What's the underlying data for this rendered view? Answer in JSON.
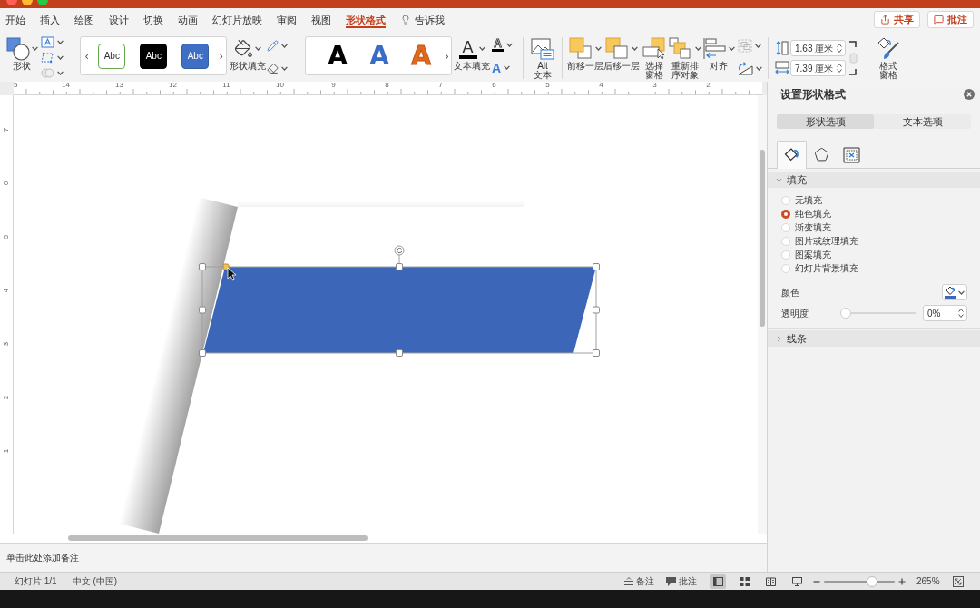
{
  "tabs": [
    {
      "label": "开始",
      "selected": false
    },
    {
      "label": "插入",
      "selected": false
    },
    {
      "label": "绘图",
      "selected": false
    },
    {
      "label": "设计",
      "selected": false
    },
    {
      "label": "切换",
      "selected": false
    },
    {
      "label": "动画",
      "selected": false
    },
    {
      "label": "幻灯片放映",
      "selected": false
    },
    {
      "label": "审阅",
      "selected": false
    },
    {
      "label": "视图",
      "selected": false
    },
    {
      "label": "形状格式",
      "selected": true
    }
  ],
  "tell_me": {
    "label": "告诉我"
  },
  "header_buttons": [
    {
      "kind": "share",
      "label": "共享"
    },
    {
      "kind": "comment",
      "label": "批注"
    }
  ],
  "ribbon": {
    "shapes": {
      "label": "形状"
    },
    "shape_styles": {
      "prev": "‹",
      "swatches": [
        {
          "kind": "outline",
          "label": "Abc"
        },
        {
          "kind": "dark",
          "label": "Abc"
        },
        {
          "kind": "blue",
          "label": "Abc"
        }
      ],
      "next": "›"
    },
    "shape_fill": {
      "label": "形状填充"
    },
    "wordart_styles": {
      "samples": [
        {
          "kind": "black",
          "label": "A"
        },
        {
          "kind": "blue",
          "label": "A"
        },
        {
          "kind": "orange",
          "label": "A"
        }
      ],
      "next": "›"
    },
    "text_fill": {
      "glyph": "A",
      "label": "文本填充"
    },
    "text_outline": {
      "glyph": "A"
    },
    "text_effects": {
      "glyph": "A"
    },
    "alt_text": {
      "lines": [
        "Alt",
        "文本"
      ]
    },
    "arrange": [
      {
        "kind": "forward",
        "lines": [
          "前移一层"
        ]
      },
      {
        "kind": "backward",
        "lines": [
          "后移一层"
        ]
      },
      {
        "kind": "selection_pane",
        "lines": [
          "选择",
          "窗格"
        ]
      },
      {
        "kind": "reorder",
        "lines": [
          "重新排",
          "序对象"
        ]
      },
      {
        "kind": "align",
        "lines": [
          "对齐"
        ]
      }
    ],
    "size": {
      "height": "1.63 厘米",
      "width": "7.39 厘米"
    },
    "format_pane": {
      "lines": [
        "格式",
        "窗格"
      ]
    }
  },
  "rulers": {
    "horizontal": [
      "5",
      "14",
      "13",
      "12",
      "11",
      "10",
      "9",
      "8",
      "7",
      "6",
      "5",
      "4",
      "3",
      "2"
    ],
    "vertical": [
      "7",
      "6",
      "5",
      "4",
      "3",
      "2",
      "1"
    ]
  },
  "notes": {
    "placeholder": "单击此处添加备注"
  },
  "format_pane": {
    "title": "设置形状格式",
    "tabs": [
      {
        "label": "形状选项",
        "selected": true
      },
      {
        "label": "文本选项",
        "selected": false
      }
    ],
    "icon_tabs": [
      {
        "kind": "fill",
        "selected": true
      },
      {
        "kind": "effects",
        "selected": false
      },
      {
        "kind": "size",
        "selected": false
      }
    ],
    "sections": [
      {
        "label": "填充",
        "expanded": true,
        "options": [
          {
            "label": "无填充",
            "selected": false
          },
          {
            "label": "纯色填充",
            "selected": true
          },
          {
            "label": "渐变填充",
            "selected": false
          },
          {
            "label": "图片或纹理填充",
            "selected": false
          },
          {
            "label": "图案填充",
            "selected": false
          },
          {
            "label": "幻灯片背景填充",
            "selected": false
          }
        ],
        "color": {
          "label": "颜色"
        },
        "transparency": {
          "label": "透明度",
          "level": 0,
          "value": "0%"
        }
      },
      {
        "label": "线条",
        "expanded": false
      }
    ]
  },
  "status_bar": {
    "slide": "幻灯片 1/1",
    "language": "中文 (中国)",
    "notes": "备注",
    "comments": "批注",
    "views": [
      {
        "kind": "normal",
        "selected": true
      },
      {
        "kind": "sorter",
        "selected": false
      },
      {
        "kind": "reading",
        "selected": false
      },
      {
        "kind": "slideshow",
        "selected": false
      }
    ],
    "zoom": {
      "level": 0.71,
      "value": "265%"
    }
  }
}
